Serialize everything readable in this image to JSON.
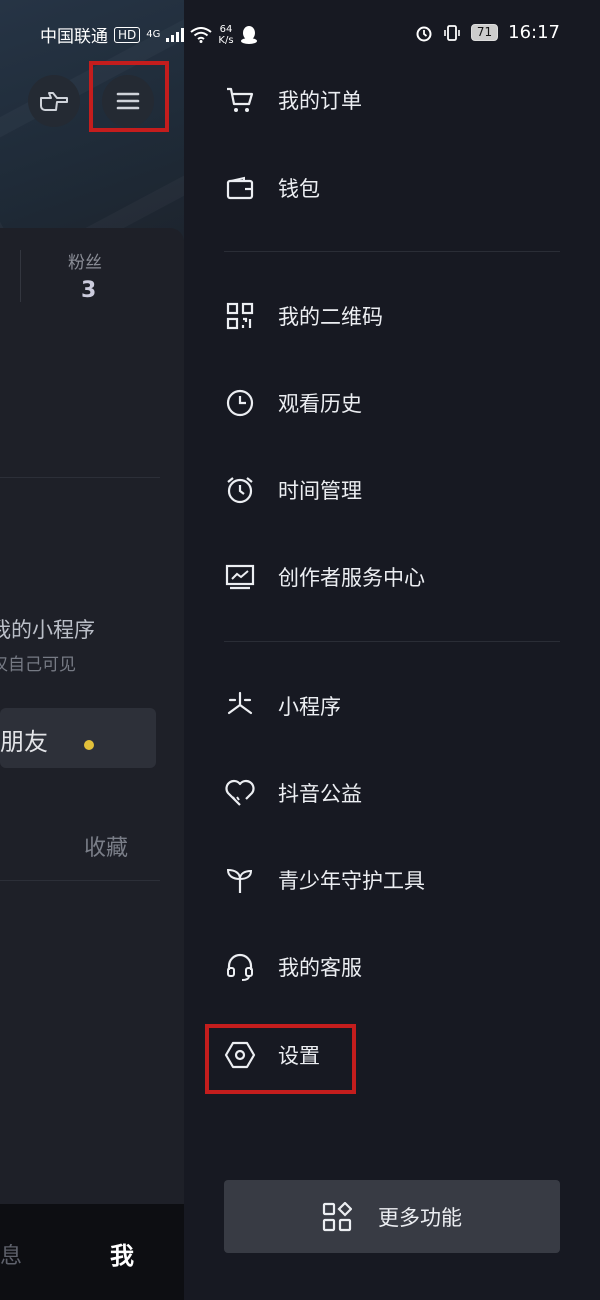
{
  "status_bar": {
    "carrier": "中国联通",
    "hd_badge": "HD",
    "network": "4G",
    "speed_value": "64",
    "speed_unit": "K/s",
    "battery": "71",
    "time": "16:17"
  },
  "background_page": {
    "fans_label": "粉丝",
    "fans_count": "3",
    "mini_program_title": "我的小程序",
    "mini_program_note": "仅自己可见",
    "add_friend": "加朋友",
    "collect_tab": "收藏",
    "bottom_tabs": {
      "messages": "消息",
      "me": "我"
    }
  },
  "drawer": {
    "items": [
      {
        "label": "我的订单",
        "icon": "cart-icon"
      },
      {
        "label": "钱包",
        "icon": "wallet-icon"
      },
      {
        "label": "我的二维码",
        "icon": "qrcode-icon"
      },
      {
        "label": "观看历史",
        "icon": "clock-icon"
      },
      {
        "label": "时间管理",
        "icon": "alarm-icon"
      },
      {
        "label": "创作者服务中心",
        "icon": "chart-monitor-icon"
      },
      {
        "label": "小程序",
        "icon": "miniprogram-icon"
      },
      {
        "label": "抖音公益",
        "icon": "heart-hand-icon"
      },
      {
        "label": "青少年守护工具",
        "icon": "sprout-icon"
      },
      {
        "label": "我的客服",
        "icon": "headset-icon"
      },
      {
        "label": "设置",
        "icon": "settings-hexagon-icon"
      }
    ],
    "more_button": "更多功能"
  },
  "colors": {
    "highlight": "#c41d1d",
    "drawer_bg": "#171922",
    "accent_dot": "#e2c03a"
  }
}
